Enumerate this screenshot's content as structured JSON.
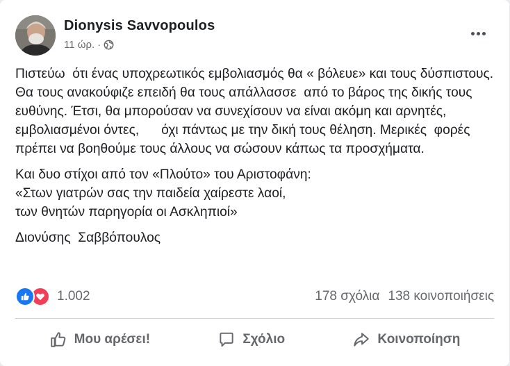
{
  "post": {
    "author": "Dionysis Savvopoulos",
    "time": "11 ώρ.",
    "separator": "·",
    "privacy_icon": "globe-icon",
    "more_icon": "more-options-icon",
    "paragraphs": [
      "Πιστεύω  ότι ένας υποχρεωτικός εμβολιασμός θα « βόλευε» και τους δύσπιστους. Θα τους ανακούφιζε επειδή θα τους απάλλασσε  από το βάρος της δικής τους ευθύνης. Έτσι, θα μπορούσαν να συνεχίσουν να είναι ακόμη και αρνητές, εμβολιασμένοι όντες,      όχι πάντως με την δική τους θέληση. Μερικές  φορές  πρέπει να βοηθούμε τους άλλους να σώσουν κάπως τα προσχήματα.",
      "Και δυο στίχοι από τον «Πλούτο» του Αριστοφάνη:\n«Στων γιατρών σας την παιδεία χαίρεστε λαοί,\nτων θνητών παρηγορία οι Ασκληπιοί»"
    ],
    "signature": "Διονύσης  Σαββόπουλος"
  },
  "stats": {
    "reactions_count": "1.002",
    "comments": "178 σχόλια",
    "shares": "138 κοινοποιήσεις",
    "reaction_icons": [
      "like-icon",
      "love-icon"
    ]
  },
  "actions": {
    "like_label": "Μου αρέσει!",
    "comment_label": "Σχόλιο",
    "share_label": "Κοινοποίηση"
  },
  "colors": {
    "like_blue": "#1877f2",
    "love_red": "#f33e58",
    "secondary_text": "#65676b"
  }
}
